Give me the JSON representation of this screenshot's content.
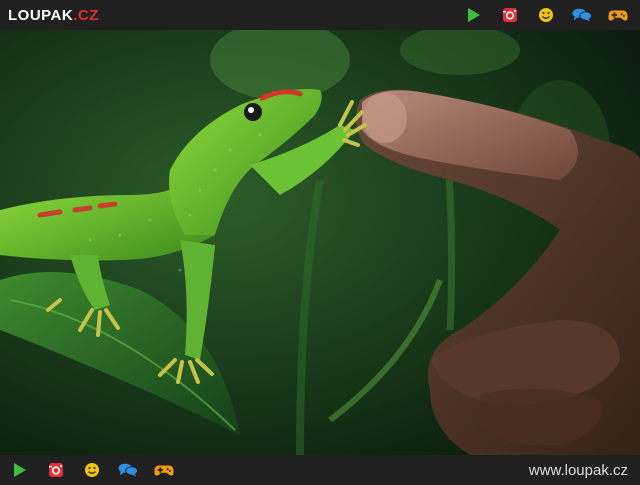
{
  "header": {
    "logo_main": "LOUPAK",
    "logo_tld": ".CZ",
    "icons": [
      "play-icon",
      "instagram-icon",
      "smiley-icon",
      "chat-icon",
      "gamepad-icon"
    ]
  },
  "footer": {
    "site_url": "www.loupak.cz",
    "icons": [
      "play-icon",
      "instagram-icon",
      "smiley-icon",
      "chat-icon",
      "gamepad-icon"
    ]
  },
  "colors": {
    "bar": "#202020",
    "play": "#3cc03c",
    "instagram": "#e0313a",
    "smiley": "#f1c40f",
    "chat": "#2f8fe0",
    "gamepad": "#f39c12"
  }
}
